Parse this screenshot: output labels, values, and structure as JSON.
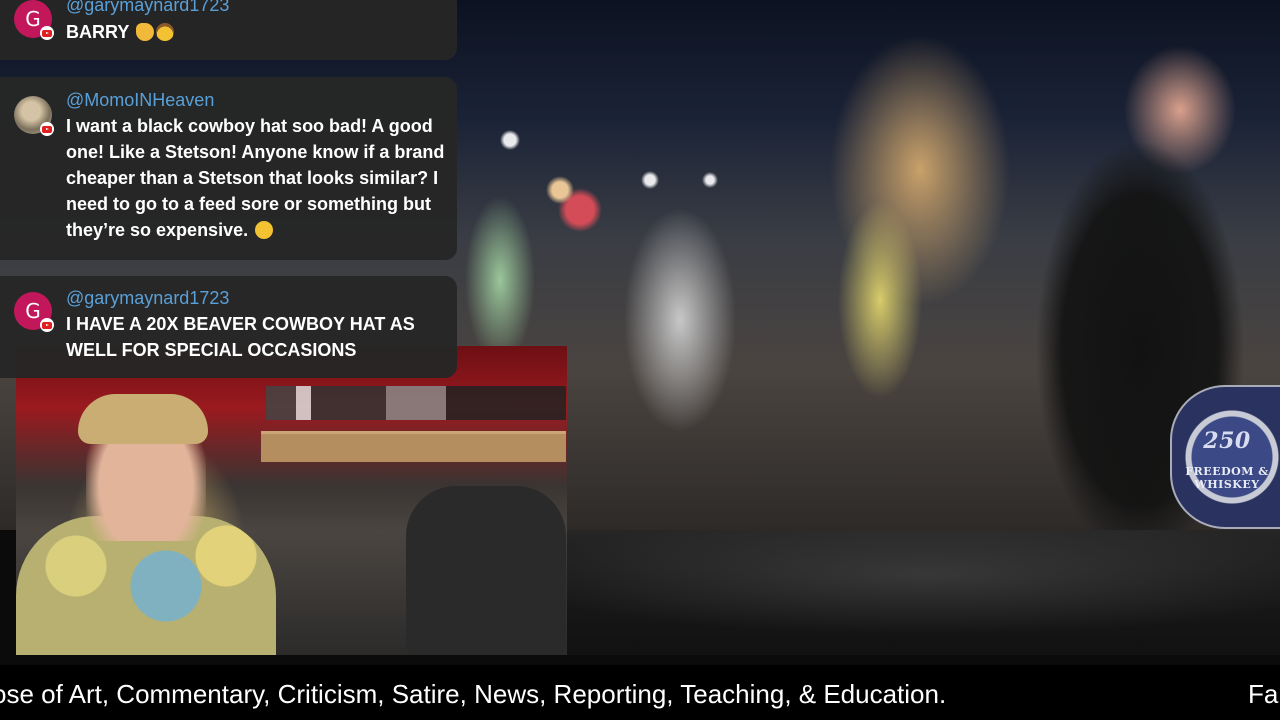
{
  "chat": {
    "messages": [
      {
        "author": "@garymaynard1723",
        "avatar_letter": "G",
        "text": "BARRY",
        "emoji": [
          "thumbs-up",
          "cowboy-face"
        ]
      },
      {
        "author": "@MomoINHeaven",
        "avatar_letter": "",
        "text": "I want a black cowboy hat soo bad! A good one! Like a Stetson! Anyone know if a brand cheaper than a Stetson that looks similar? I need to go to a feed sore or something but they’re so expensive.",
        "emoji": [
          "slightly-frowning-face"
        ]
      },
      {
        "author": "@garymaynard1723",
        "avatar_letter": "G",
        "text": "I HAVE A 20X BEAVER COWBOY HAT AS WELL FOR SPECIAL OCCASIONS",
        "emoji": []
      }
    ],
    "source_badge": "youtube-icon"
  },
  "video": {
    "patch_number": "250",
    "patch_text": "FREEDOM & WHISKEY"
  },
  "ticker": {
    "text": "ose of Art, Commentary, Criticism, Satire, News, Reporting, Teaching, & Education.",
    "text_next": "Fa"
  },
  "colors": {
    "author": "#5aa0d8",
    "avatar_bg": "#c2185b",
    "chat_bg": "#262626",
    "youtube_red": "#e02020"
  }
}
